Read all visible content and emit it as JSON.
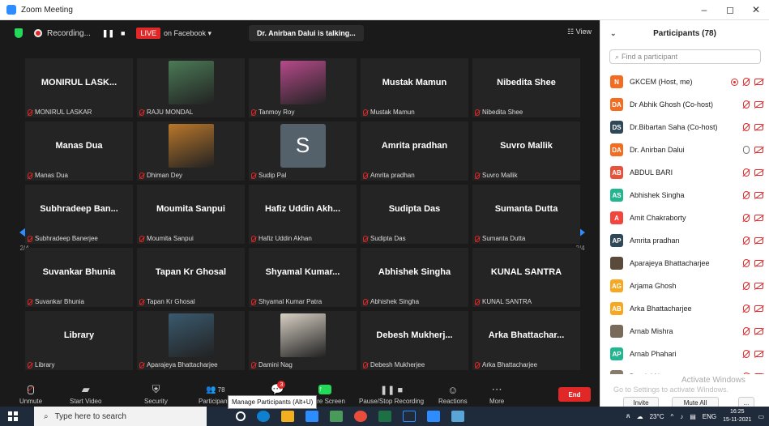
{
  "window": {
    "title": "Zoom Meeting",
    "controls": [
      "–",
      "◻",
      "✕"
    ]
  },
  "topbar": {
    "recording_label": "Recording...",
    "recording_pause": "❚❚",
    "recording_stop": "■",
    "live_label": "LIVE",
    "live_destination": "on Facebook ▾",
    "talking": "Dr. Anirban Dalui is talking...",
    "view_label": "☷ View"
  },
  "navigation": {
    "left_page": "2/4",
    "right_page": "2/4"
  },
  "tiles": [
    {
      "display": "MONIRUL LASK...",
      "name": "MONIRUL LASKAR",
      "kind": "text"
    },
    {
      "display": "",
      "name": "RAJU MONDAL",
      "kind": "photo",
      "photo_color": "#4b7a56"
    },
    {
      "display": "",
      "name": "Tanmoy Roy",
      "kind": "photo",
      "photo_color": "#b54a8a"
    },
    {
      "display": "Mustak Mamun",
      "name": "Mustak Mamun",
      "kind": "text"
    },
    {
      "display": "Nibedita Shee",
      "name": "Nibedita Shee",
      "kind": "text"
    },
    {
      "display": "Manas Dua",
      "name": "Manas Dua",
      "kind": "text"
    },
    {
      "display": "",
      "name": "Dhiman Dey",
      "kind": "photo",
      "photo_color": "#b9772b"
    },
    {
      "display": "S",
      "name": "Sudip Pal",
      "kind": "avatar"
    },
    {
      "display": "Amrita pradhan",
      "name": "Amrita pradhan",
      "kind": "text"
    },
    {
      "display": "Suvro Mallik",
      "name": "Suvro Mallik",
      "kind": "text"
    },
    {
      "display": "Subhradeep Ban...",
      "name": "Subhradeep Banerjee",
      "kind": "text"
    },
    {
      "display": "Moumita Sanpui",
      "name": "Moumita Sanpui",
      "kind": "text"
    },
    {
      "display": "Hafiz Uddin Akh...",
      "name": "Hafiz Uddin Akhan",
      "kind": "text"
    },
    {
      "display": "Sudipta Das",
      "name": "Sudipta Das",
      "kind": "text"
    },
    {
      "display": "Sumanta Dutta",
      "name": "Sumanta Dutta",
      "kind": "text"
    },
    {
      "display": "Suvankar Bhunia",
      "name": "Suvankar Bhunia",
      "kind": "text"
    },
    {
      "display": "Tapan Kr Ghosal",
      "name": "Tapan Kr Ghosal",
      "kind": "text"
    },
    {
      "display": "Shyamal Kumar...",
      "name": "Shyamal Kumar Patra",
      "kind": "text"
    },
    {
      "display": "Abhishek Singha",
      "name": "Abhishek Singha",
      "kind": "text"
    },
    {
      "display": "KUNAL SANTRA",
      "name": "KUNAL SANTRA",
      "kind": "text"
    },
    {
      "display": "Library",
      "name": "Library",
      "kind": "text"
    },
    {
      "display": "",
      "name": "Aparajeya Bhattacharjee",
      "kind": "photo",
      "photo_color": "#3a5a6e"
    },
    {
      "display": "",
      "name": "Damini Nag",
      "kind": "photo",
      "photo_color": "#d8d0c4"
    },
    {
      "display": "Debesh Mukherj...",
      "name": "Debesh Mukherjee",
      "kind": "text"
    },
    {
      "display": "Arka Bhattachar...",
      "name": "Arka Bhattacharjee",
      "kind": "text"
    }
  ],
  "toolbar": {
    "unmute": "Unmute",
    "start_video": "Start Video",
    "security": "Security",
    "participants": "Participants",
    "participants_count": "78",
    "chat_badge": "3",
    "share_screen": "Share Screen",
    "recording": "Pause/Stop Recording",
    "reactions": "Reactions",
    "more": "More",
    "end": "End",
    "tooltip": "Manage Participants (Alt+U)"
  },
  "panel": {
    "title": "Participants (78)",
    "search_placeholder": "Find a participant",
    "participants": [
      {
        "initials": "N",
        "name": "GKCEM (Host, me)",
        "color": "#f26d21",
        "status": "host"
      },
      {
        "initials": "DA",
        "name": "Dr Abhik Ghosh (Co-host)",
        "color": "#f26d21",
        "status": "muted"
      },
      {
        "initials": "DS",
        "name": "Dr.Bibartan Saha (Co-host)",
        "color": "#2f4858",
        "status": "muted"
      },
      {
        "initials": "DA",
        "name": "Dr. Anirban Dalui",
        "color": "#f26d21",
        "status": "speaking"
      },
      {
        "initials": "AB",
        "name": "ABDUL BARI",
        "color": "#e5533c",
        "status": "muted"
      },
      {
        "initials": "AS",
        "name": "Abhishek Singha",
        "color": "#23b590",
        "status": "muted"
      },
      {
        "initials": "A",
        "name": "Amit Chakraborty",
        "color": "#f2453d",
        "status": "muted"
      },
      {
        "initials": "AP",
        "name": "Amrita pradhan",
        "color": "#2f4858",
        "status": "muted"
      },
      {
        "initials": "",
        "name": "Aparajeya Bhattacharjee",
        "color": "#5a4a3a",
        "status": "muted"
      },
      {
        "initials": "AG",
        "name": "Arjama Ghosh",
        "color": "#f7a823",
        "status": "muted"
      },
      {
        "initials": "AB",
        "name": "Arka Bhattacharjee",
        "color": "#f7a823",
        "status": "muted"
      },
      {
        "initials": "",
        "name": "Arnab Mishra",
        "color": "#7a6a5a",
        "status": "muted"
      },
      {
        "initials": "AP",
        "name": "Arnab Phahari",
        "color": "#23b590",
        "status": "muted"
      },
      {
        "initials": "",
        "name": "Damini Nag",
        "color": "#8a7a6a",
        "status": "muted"
      }
    ],
    "watermark_title": "Activate Windows",
    "watermark_sub": "Go to Settings to activate Windows.",
    "invite": "Invite",
    "mute_all": "Mute All",
    "more": "..."
  },
  "taskbar": {
    "search_placeholder": "Type here to search",
    "weather": "23°C",
    "language": "ENG",
    "time": "16:25",
    "date": "15-11-2021"
  }
}
